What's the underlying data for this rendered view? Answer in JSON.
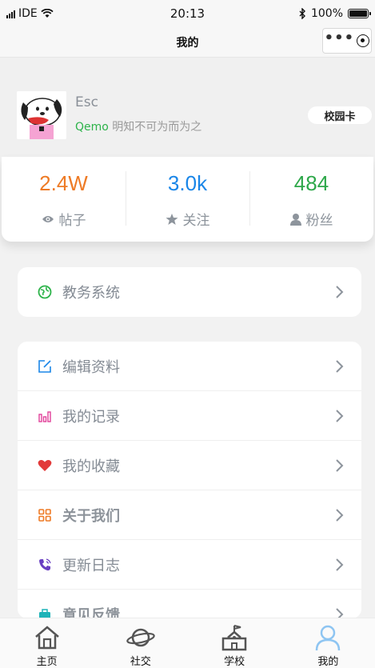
{
  "statusbar": {
    "carrier": "IDE",
    "time": "20:13",
    "battery": "100%"
  },
  "navbar": {
    "title": "我的",
    "more": "•••"
  },
  "profile": {
    "name": "Esc",
    "bio_brand": "Qemo",
    "bio_text": "明知不可为而为之",
    "campus_button": "校园卡"
  },
  "stats": [
    {
      "value": "2.4W",
      "label": "帖子",
      "icon": "eye-icon",
      "color": "#ee7b26"
    },
    {
      "value": "3.0k",
      "label": "关注",
      "icon": "star-icon",
      "color": "#1a86e8"
    },
    {
      "value": "484",
      "label": "粉丝",
      "icon": "user-icon",
      "color": "#2ea84a"
    }
  ],
  "menu_top": [
    {
      "label": "教务系统",
      "icon": "globe-icon",
      "color": "#2db34a"
    }
  ],
  "menu_main": [
    {
      "label": "编辑资料",
      "icon": "edit-icon",
      "color": "#1a86e8"
    },
    {
      "label": "我的记录",
      "icon": "bar-chart-icon",
      "color": "#e0409a"
    },
    {
      "label": "我的收藏",
      "icon": "heart-icon",
      "color": "#e23a3a"
    },
    {
      "label": "关于我们",
      "icon": "grid-icon",
      "color": "#ee7b26"
    },
    {
      "label": "更新日志",
      "icon": "phone-icon",
      "color": "#6a3fc2"
    },
    {
      "label": "意见反馈",
      "icon": "briefcase-icon",
      "color": "#1db3b8"
    }
  ],
  "tabbar": [
    {
      "label": "主页",
      "icon": "home-icon"
    },
    {
      "label": "社交",
      "icon": "planet-icon"
    },
    {
      "label": "学校",
      "icon": "school-icon"
    },
    {
      "label": "我的",
      "icon": "person-icon",
      "active_color": "#8ec5f2"
    }
  ]
}
